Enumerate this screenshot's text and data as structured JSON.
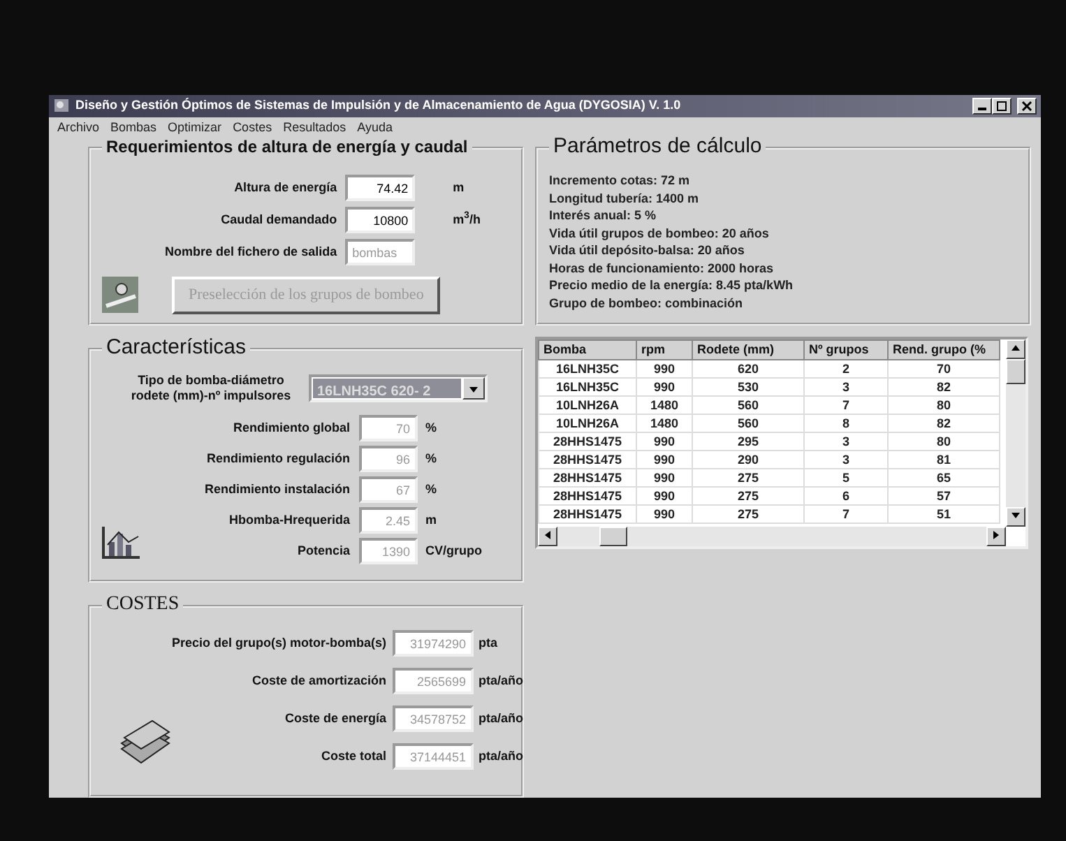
{
  "window": {
    "title": "Diseño y Gestión Óptimos de Sistemas de Impulsión y de Almacenamiento de Agua (DYGOSIA) V. 1.0"
  },
  "menu": [
    "Archivo",
    "Bombas",
    "Optimizar",
    "Costes",
    "Resultados",
    "Ayuda"
  ],
  "requerimientos": {
    "title": "Requerimientos de altura de energía y caudal",
    "fields": [
      {
        "label": "Altura de energía",
        "value": "74.42",
        "unit": "m",
        "disabled": false
      },
      {
        "label": "Caudal demandado",
        "value": "10800",
        "unit": "m$^{3}$/h",
        "disabled": false
      },
      {
        "label": "Nombre del fichero de salida",
        "value": "bombas",
        "disabled": true
      }
    ],
    "button": {
      "label": "Preselección de los grupos de bombeo",
      "disabled": true
    }
  },
  "parametros": {
    "title": "Parámetros de cálculo",
    "lines": [
      "Incremento cotas: 72 m",
      "Longitud tubería: 1400 m",
      "Interés anual: 5 %",
      "Vida útil grupos de bombeo:  20 años",
      "Vida útil depósito-balsa:  20 años",
      "Horas de funcionamiento:  2000 horas",
      "Precio medio de la energía: 8.45 pta/kWh",
      "Grupo de bombeo: combinación"
    ]
  },
  "caracteristicas": {
    "title": "Características",
    "select": {
      "label": "Tipo de bomba-diámetro rodete (mm)-nº impulsores",
      "value": "16LNH35C 620- 2"
    },
    "fields": [
      {
        "label": "Rendimiento global",
        "value": "70",
        "unit": "%",
        "disabled": true
      },
      {
        "label": "Rendimiento regulación",
        "value": "96",
        "unit": "%",
        "disabled": true
      },
      {
        "label": "Rendimiento instalación",
        "value": "67",
        "unit": "%",
        "disabled": true
      },
      {
        "label": "Hbomba-Hrequerida",
        "value": "2.45",
        "unit": "m",
        "disabled": true
      },
      {
        "label": "Potencia",
        "value": "1390",
        "unit": "CV/grupo",
        "disabled": true
      }
    ]
  },
  "table": {
    "columns": [
      "Bomba",
      "rpm",
      "Rodete (mm)",
      "Nº grupos",
      "Rend. grupo (%"
    ],
    "rows": [
      [
        "16LNH35C",
        "990",
        "620",
        "2",
        "70"
      ],
      [
        "16LNH35C",
        "990",
        "530",
        "3",
        "82"
      ],
      [
        "10LNH26A",
        "1480",
        "560",
        "7",
        "80"
      ],
      [
        "10LNH26A",
        "1480",
        "560",
        "8",
        "82"
      ],
      [
        "28HHS1475",
        "990",
        "295",
        "3",
        "80"
      ],
      [
        "28HHS1475",
        "990",
        "290",
        "3",
        "81"
      ],
      [
        "28HHS1475",
        "990",
        "275",
        "5",
        "65"
      ],
      [
        "28HHS1475",
        "990",
        "275",
        "6",
        "57"
      ],
      [
        "28HHS1475",
        "990",
        "275",
        "7",
        "51"
      ]
    ]
  },
  "costes": {
    "title": "COSTES",
    "fields": [
      {
        "label": "Precio del grupo(s) motor-bomba(s)",
        "value": "31974290",
        "unit": "pta",
        "disabled": true
      },
      {
        "label": "Coste de amortización",
        "value": "2565699",
        "unit": "pta/año",
        "disabled": true
      },
      {
        "label": "Coste de energía",
        "value": "34578752",
        "unit": "pta/año",
        "disabled": true
      },
      {
        "label": "Coste total",
        "value": "37144451",
        "unit": "pta/año",
        "disabled": true
      }
    ]
  }
}
